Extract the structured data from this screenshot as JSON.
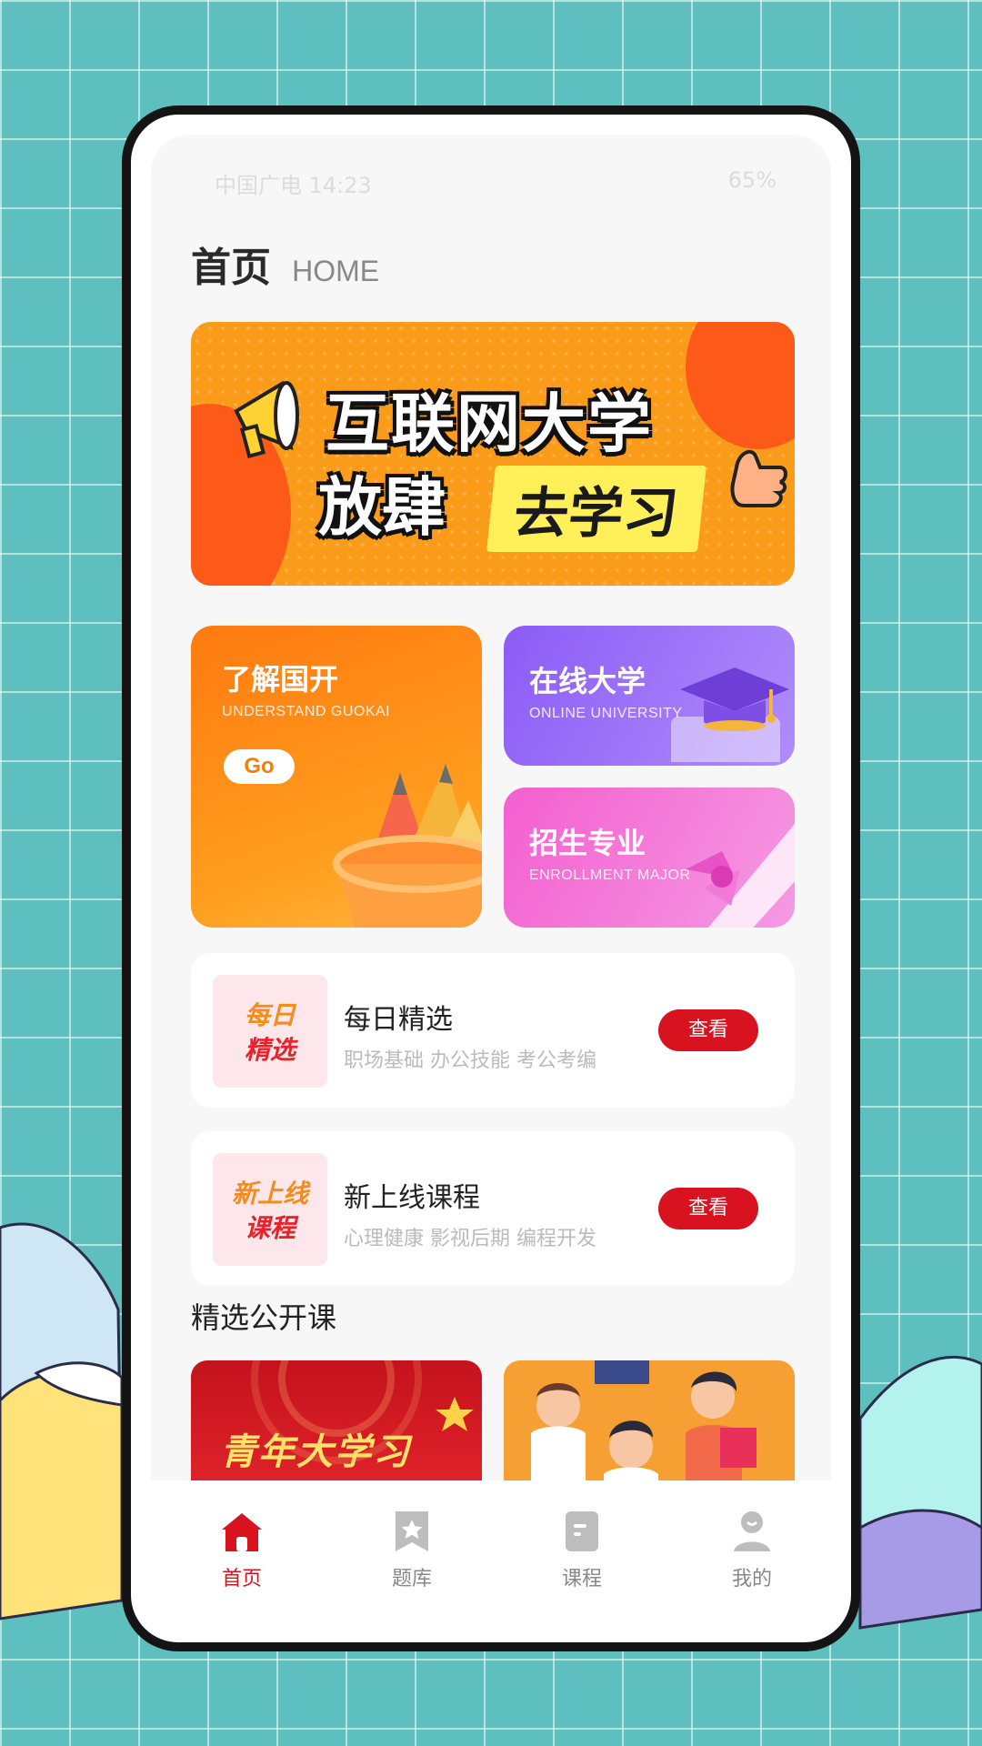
{
  "status_bar": {
    "carrier_time": "中国广电 14:23",
    "battery": "65%"
  },
  "header": {
    "title": "首页",
    "subtitle": "HOME"
  },
  "banner": {
    "line1": "互联网大学",
    "line2": "放肆",
    "cta": "去学习"
  },
  "feature_cards": [
    {
      "title": "了解国开",
      "subtitle": "UNDERSTAND GUOKAI",
      "button": "Go"
    },
    {
      "title": "在线大学",
      "subtitle": "ONLINE UNIVERSITY"
    },
    {
      "title": "招生专业",
      "subtitle": "ENROLLMENT MAJOR"
    }
  ],
  "list_cards": [
    {
      "thumb_line1": "每日",
      "thumb_line2": "精选",
      "title": "每日精选",
      "tags": "职场基础  办公技能  考公考编",
      "button": "查看"
    },
    {
      "thumb_line1": "新上线",
      "thumb_line2": "课程",
      "title": "新上线课程",
      "tags": "心理健康  影视后期  编程开发",
      "button": "查看"
    }
  ],
  "section": {
    "title": "精选公开课"
  },
  "courses": [
    {
      "banner_text": "青年大学习"
    }
  ],
  "tabbar": {
    "items": [
      {
        "label": "首页",
        "icon": "home-icon",
        "active": true
      },
      {
        "label": "题库",
        "icon": "bookmark-star-icon",
        "active": false
      },
      {
        "label": "课程",
        "icon": "document-icon",
        "active": false
      },
      {
        "label": "我的",
        "icon": "user-icon",
        "active": false
      }
    ],
    "active_color": "#d8121e",
    "inactive_color": "#bdbdbd"
  },
  "colors": {
    "accent": "#d8121e",
    "background": "#5dbfbe"
  }
}
